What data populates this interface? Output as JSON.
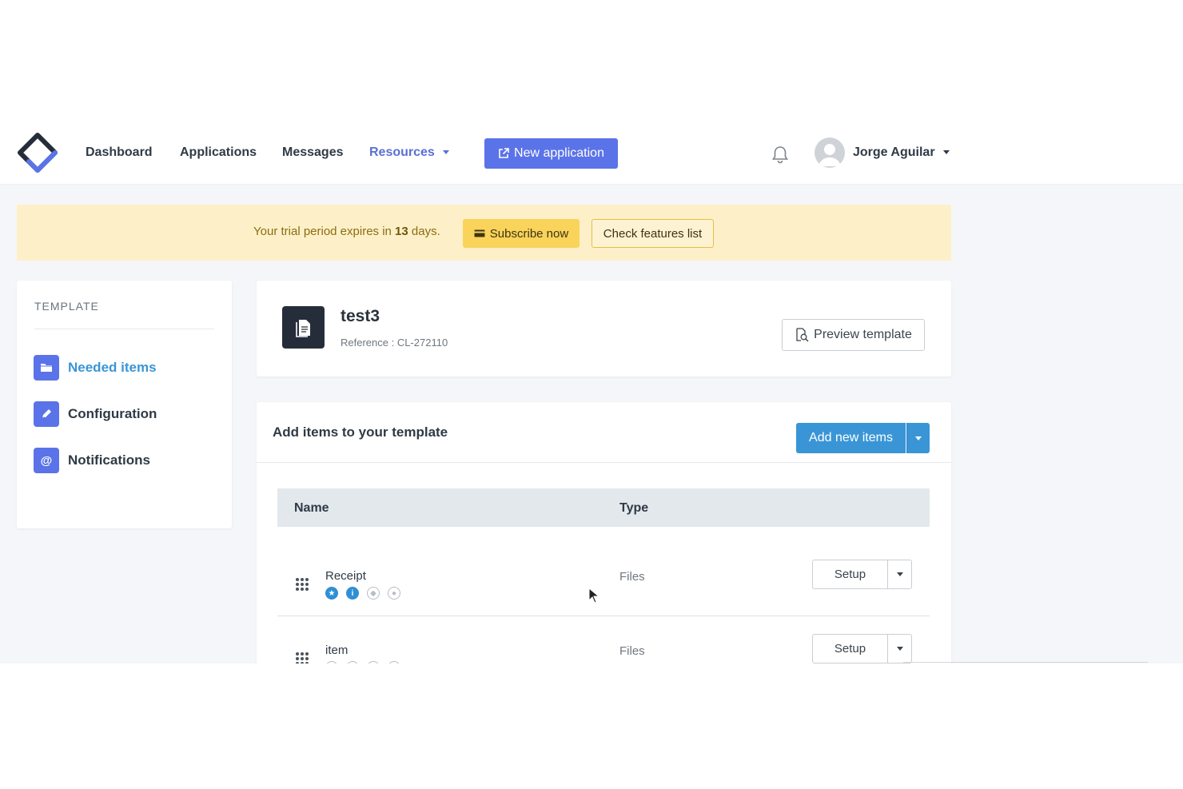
{
  "nav": {
    "links": [
      "Dashboard",
      "Applications",
      "Messages",
      "Resources"
    ],
    "new_application": "New application",
    "user_name": "Jorge Aguilar"
  },
  "banner": {
    "text_before": "Your trial period expires in ",
    "days": "13",
    "text_after": " days.",
    "subscribe": "Subscribe now",
    "features": "Check features list"
  },
  "sidebar": {
    "title": "TEMPLATE",
    "items": [
      {
        "label": "Needed items",
        "icon": "folder-icon"
      },
      {
        "label": "Configuration",
        "icon": "pencil-icon"
      },
      {
        "label": "Notifications",
        "icon": "at-icon"
      }
    ]
  },
  "template": {
    "name": "test3",
    "reference": "Reference : CL-272110",
    "preview": "Preview template"
  },
  "items": {
    "title": "Add items to your template",
    "add_button": "Add new items",
    "columns": [
      "Name",
      "Type"
    ],
    "setup_label": "Setup",
    "rows": [
      {
        "name": "Receipt",
        "type": "Files"
      },
      {
        "name": "item",
        "type": "Files"
      }
    ]
  },
  "colors": {
    "primary": "#5b73e8",
    "accent_blue": "#3a95d6",
    "banner_bg": "#fdf0c8",
    "subscribe_bg": "#f9d35a"
  }
}
